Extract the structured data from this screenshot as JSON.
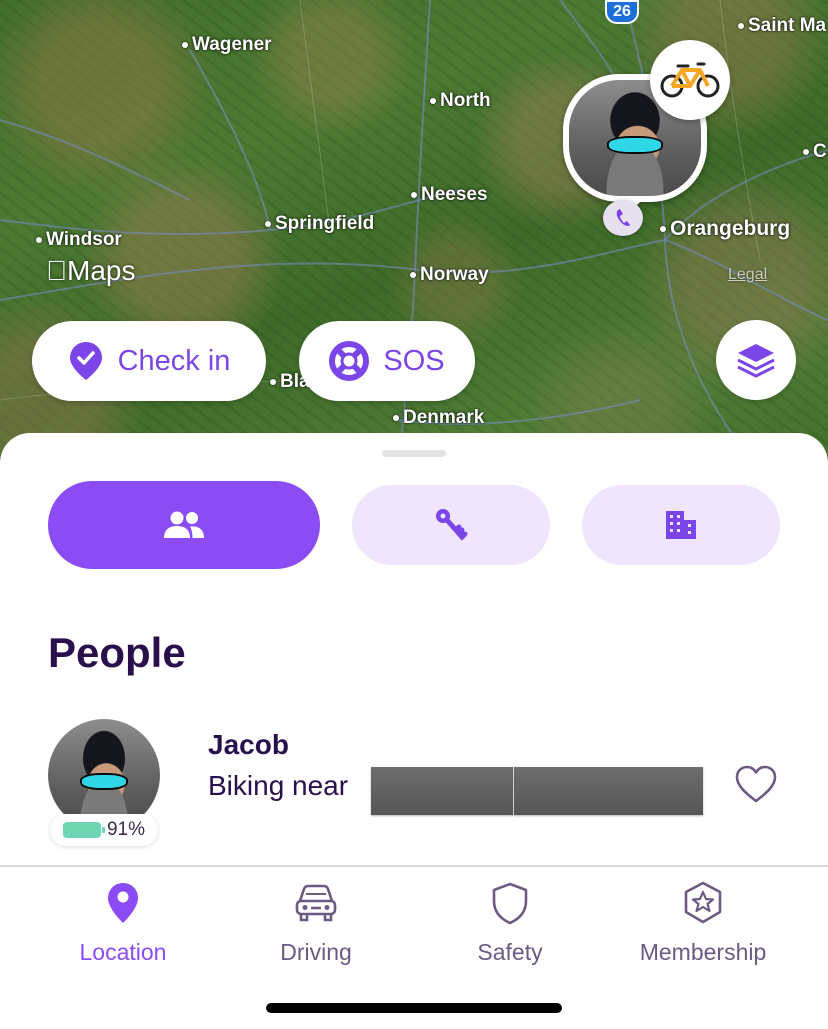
{
  "map": {
    "places": [
      {
        "label": "Wagener"
      },
      {
        "label": "North"
      },
      {
        "label": "Neeses"
      },
      {
        "label": "Springfield"
      },
      {
        "label": "Windsor"
      },
      {
        "label": "Norway"
      },
      {
        "label": "Orangeburg"
      },
      {
        "label": "Denmark"
      },
      {
        "label": "Saint Ma"
      },
      {
        "label": "Bla"
      },
      {
        "label": "C"
      }
    ],
    "maps_logo": "Maps",
    "legal": "Legal",
    "highway_shield": "26",
    "buttons": {
      "check_in": "Check in",
      "sos": "SOS"
    }
  },
  "segments": [
    {
      "icon": "people-icon",
      "active": true
    },
    {
      "icon": "keys-icon",
      "active": false
    },
    {
      "icon": "building-icon",
      "active": false
    }
  ],
  "people": {
    "title": "People",
    "members": [
      {
        "name": "Jacob",
        "status": "Biking near",
        "battery": "91%",
        "battery_level": 0.91
      }
    ]
  },
  "tabbar": {
    "tabs": [
      {
        "label": "Location",
        "icon": "location-pin-icon",
        "active": true
      },
      {
        "label": "Driving",
        "icon": "car-icon",
        "active": false
      },
      {
        "label": "Safety",
        "icon": "shield-icon",
        "active": false
      },
      {
        "label": "Membership",
        "icon": "star-badge-icon",
        "active": false
      }
    ]
  },
  "colors": {
    "accent": "#8b4cf5",
    "accent_light": "#efe5fd",
    "text_dark": "#2a0f4d",
    "battery": "#6fd6b1"
  }
}
